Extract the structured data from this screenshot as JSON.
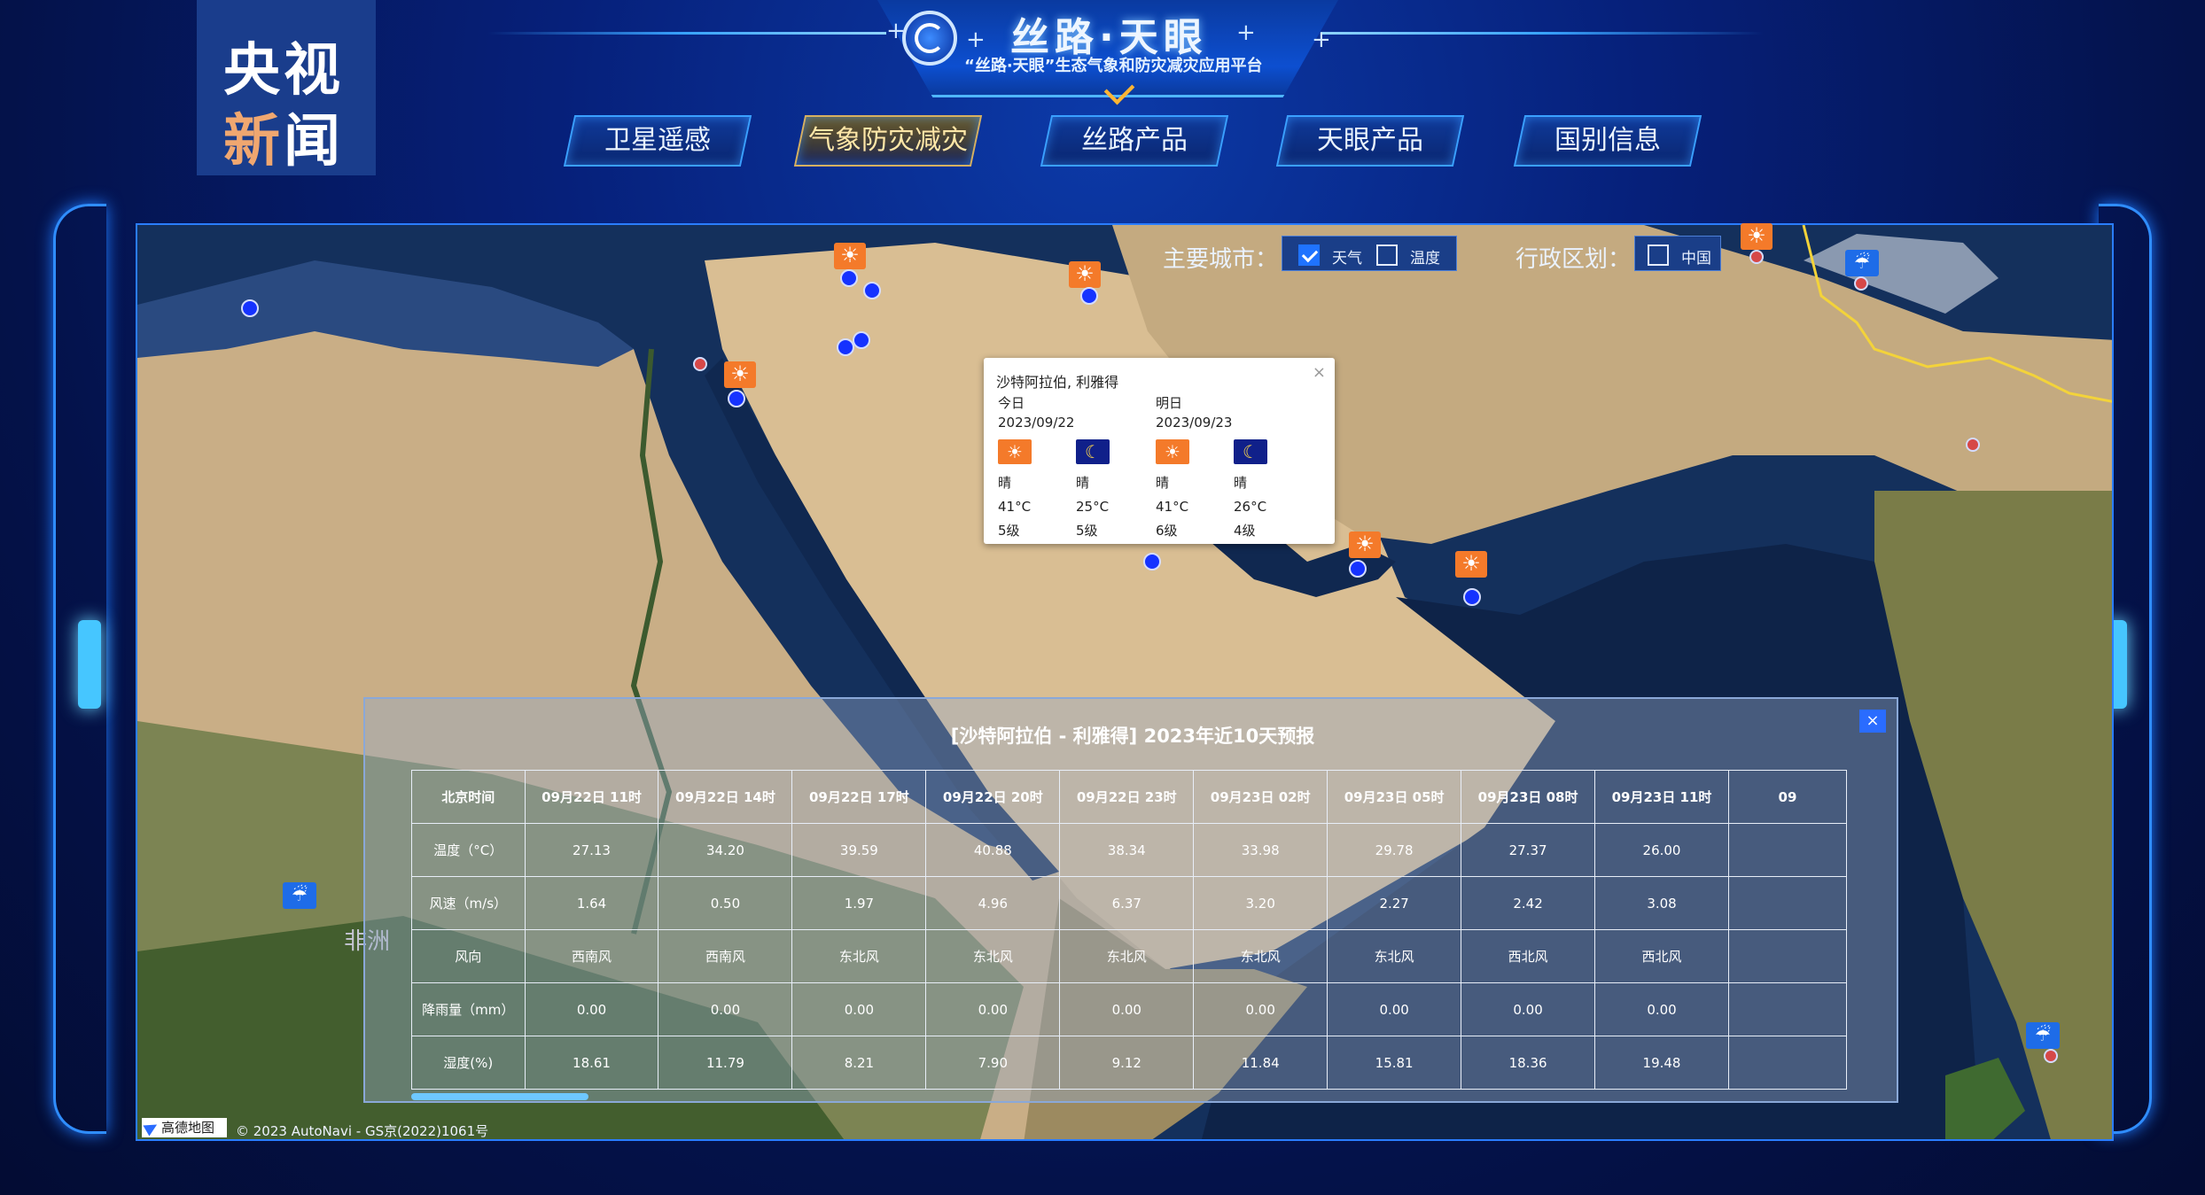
{
  "watermark": {
    "top": "央视",
    "bottom_a": "新",
    "bottom_b": "闻"
  },
  "header": {
    "title": "丝路·天眼",
    "subtitle": "“丝路·天眼”生态气象和防灾减灾应用平台"
  },
  "nav": [
    {
      "label": "卫星遥感",
      "active": false
    },
    {
      "label": "气象防灾减灾",
      "active": true
    },
    {
      "label": "丝路产品",
      "active": false
    },
    {
      "label": "天眼产品",
      "active": false
    },
    {
      "label": "国别信息",
      "active": false
    }
  ],
  "controls": {
    "cities_label": "主要城市：",
    "weather_checkbox": {
      "label": "天气",
      "checked": true
    },
    "temp_checkbox": {
      "label": "温度",
      "checked": false
    },
    "admin_label": "行政区划：",
    "china_checkbox": {
      "label": "中国",
      "checked": false
    }
  },
  "map": {
    "africa_label": "非洲",
    "provider": "高德地图",
    "copyright": "© 2023 AutoNavi - GS京(2022)1061号"
  },
  "popup": {
    "city": "沙特阿拉伯, 利雅得",
    "days": [
      {
        "label": "今日",
        "date": "2023/09/22",
        "day": {
          "icon": "sun-icon",
          "weather": "晴",
          "temp": "41°C",
          "wind": "5级"
        },
        "night": {
          "icon": "moon-icon",
          "weather": "晴",
          "temp": "25°C",
          "wind": "5级"
        }
      },
      {
        "label": "明日",
        "date": "2023/09/23",
        "day": {
          "icon": "sun-icon",
          "weather": "晴",
          "temp": "41°C",
          "wind": "6级"
        },
        "night": {
          "icon": "moon-icon",
          "weather": "晴",
          "temp": "26°C",
          "wind": "4级"
        }
      }
    ]
  },
  "forecast": {
    "title": "[沙特阿拉伯 - 利雅得]   2023年近10天预报",
    "row_headers": [
      "北京时间",
      "温度（°C）",
      "风速（m/s）",
      "风向",
      "降雨量（mm）",
      "湿度(%)"
    ],
    "columns": [
      {
        "time": "09月22日 11时",
        "temp": "27.13",
        "wind_speed": "1.64",
        "wind_dir": "西南风",
        "rain": "0.00",
        "humidity": "18.61"
      },
      {
        "time": "09月22日 14时",
        "temp": "34.20",
        "wind_speed": "0.50",
        "wind_dir": "西南风",
        "rain": "0.00",
        "humidity": "11.79"
      },
      {
        "time": "09月22日 17时",
        "temp": "39.59",
        "wind_speed": "1.97",
        "wind_dir": "东北风",
        "rain": "0.00",
        "humidity": "8.21"
      },
      {
        "time": "09月22日 20时",
        "temp": "40.88",
        "wind_speed": "4.96",
        "wind_dir": "东北风",
        "rain": "0.00",
        "humidity": "7.90"
      },
      {
        "time": "09月22日 23时",
        "temp": "38.34",
        "wind_speed": "6.37",
        "wind_dir": "东北风",
        "rain": "0.00",
        "humidity": "9.12"
      },
      {
        "time": "09月23日 02时",
        "temp": "33.98",
        "wind_speed": "3.20",
        "wind_dir": "东北风",
        "rain": "0.00",
        "humidity": "11.84"
      },
      {
        "time": "09月23日 05时",
        "temp": "29.78",
        "wind_speed": "2.27",
        "wind_dir": "东北风",
        "rain": "0.00",
        "humidity": "15.81"
      },
      {
        "time": "09月23日 08时",
        "temp": "27.37",
        "wind_speed": "2.42",
        "wind_dir": "西北风",
        "rain": "0.00",
        "humidity": "18.36"
      },
      {
        "time": "09月23日 11时",
        "temp": "26.00",
        "wind_speed": "3.08",
        "wind_dir": "西北风",
        "rain": "0.00",
        "humidity": "19.48"
      },
      {
        "time": "09",
        "temp": "",
        "wind_speed": "",
        "wind_dir": "",
        "rain": "",
        "humidity": ""
      }
    ]
  },
  "colors": {
    "sun": "#f47a2a",
    "rain": "#1e6ce8",
    "city_dot": "#1532ff",
    "accent": "#2a7dff"
  }
}
